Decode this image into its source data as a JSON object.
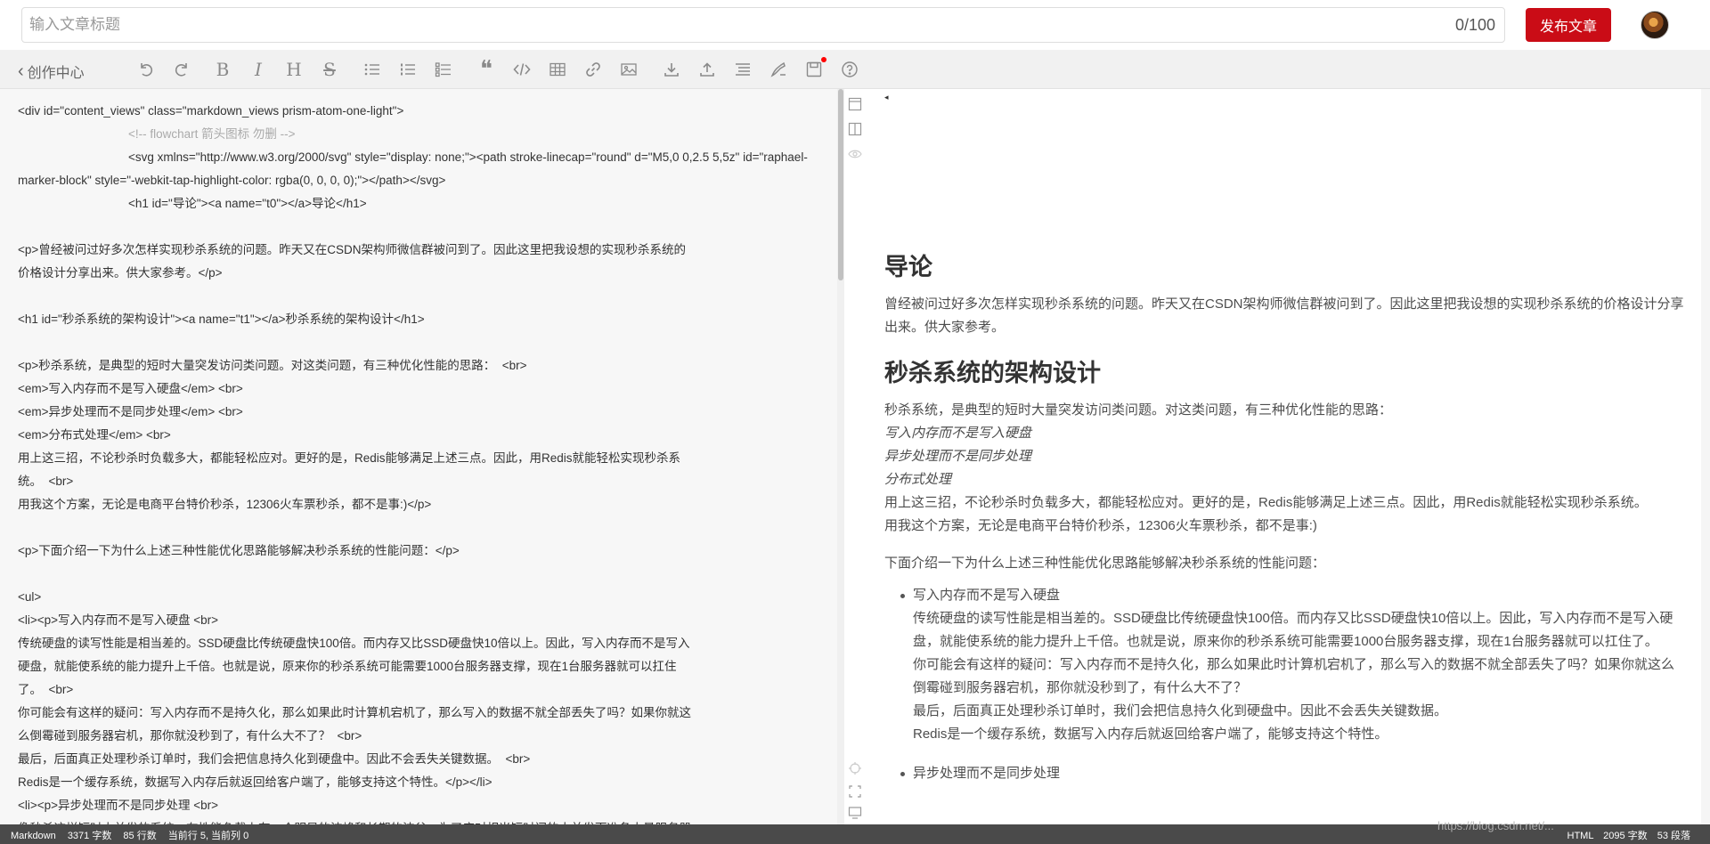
{
  "title": {
    "placeholder": "输入文章标题",
    "count": "0/100"
  },
  "publish_label": "发布文章",
  "toolbar": {
    "back_label": "创作中心"
  },
  "editor_lines": [
    {
      "t": "<div id=\"content_views\" class=\"markdown_views prism-atom-one-light\">",
      "k": "n"
    },
    {
      "t": "<!-- flowchart 箭头图标 勿删 -->",
      "k": "c"
    },
    {
      "t": "<svg xmlns=\"http://www.w3.org/2000/svg\" style=\"display: none;\"><path stroke-linecap=\"round\" d=\"M5,0 0,2.5 5,5z\" id=\"raphael-",
      "k": "i"
    },
    {
      "t": "marker-block\" style=\"-webkit-tap-highlight-color: rgba(0, 0, 0, 0);\"></path></svg>",
      "k": "n"
    },
    {
      "t": "<h1 id=\"导论\"><a name=\"t0\"></a>导论</h1>",
      "k": "i"
    },
    {
      "t": "",
      "k": "b"
    },
    {
      "t": "<p>曾经被问过好多次怎样实现秒杀系统的问题。昨天又在CSDN架构师微信群被问到了。因此这里把我设想的实现秒杀系统的",
      "k": "n"
    },
    {
      "t": "价格设计分享出来。供大家参考。</p>",
      "k": "n"
    },
    {
      "t": "",
      "k": "b"
    },
    {
      "t": "<h1 id=\"秒杀系统的架构设计\"><a name=\"t1\"></a>秒杀系统的架构设计</h1>",
      "k": "n"
    },
    {
      "t": "",
      "k": "b"
    },
    {
      "t": "<p>秒杀系统，是典型的短时大量突发访问类问题。对这类问题，有三种优化性能的思路：  <br>",
      "k": "n"
    },
    {
      "t": "<em>写入内存而不是写入硬盘</em> <br>",
      "k": "n"
    },
    {
      "t": "<em>异步处理而不是同步处理</em> <br>",
      "k": "n"
    },
    {
      "t": "<em>分布式处理</em> <br>",
      "k": "n"
    },
    {
      "t": "用上这三招，不论秒杀时负载多大，都能轻松应对。更好的是，Redis能够满足上述三点。因此，用Redis就能轻松实现秒杀系",
      "k": "n"
    },
    {
      "t": "统。  <br>",
      "k": "n"
    },
    {
      "t": "用我这个方案，无论是电商平台特价秒杀，12306火车票秒杀，都不是事:)</p>",
      "k": "n"
    },
    {
      "t": "",
      "k": "b"
    },
    {
      "t": "<p>下面介绍一下为什么上述三种性能优化思路能够解决秒杀系统的性能问题：</p>",
      "k": "n"
    },
    {
      "t": "",
      "k": "b"
    },
    {
      "t": "<ul>",
      "k": "n"
    },
    {
      "t": "<li><p>写入内存而不是写入硬盘 <br>",
      "k": "n"
    },
    {
      "t": "传统硬盘的读写性能是相当差的。SSD硬盘比传统硬盘快100倍。而内存又比SSD硬盘快10倍以上。因此，写入内存而不是写入",
      "k": "n"
    },
    {
      "t": "硬盘，就能使系统的能力提升上千倍。也就是说，原来你的秒杀系统可能需要1000台服务器支撑，现在1台服务器就可以扛住",
      "k": "n"
    },
    {
      "t": "了。  <br>",
      "k": "n"
    },
    {
      "t": "你可能会有这样的疑问：写入内存而不是持久化，那么如果此时计算机宕机了，那么写入的数据不就全部丢失了吗？如果你就这",
      "k": "n"
    },
    {
      "t": "么倒霉碰到服务器宕机，那你就没秒到了，有什么大不了？  <br>",
      "k": "n"
    },
    {
      "t": "最后，后面真正处理秒杀订单时，我们会把信息持久化到硬盘中。因此不会丢失关键数据。  <br>",
      "k": "n"
    },
    {
      "t": "Redis是一个缓存系统，数据写入内存后就返回给客户端了，能够支持这个特性。</p></li>",
      "k": "n"
    },
    {
      "t": "<li><p>异步处理而不是同步处理 <br>",
      "k": "n"
    },
    {
      "t": "像秒杀这样短时大并发的系统，在性能负载上有一个明显的波峰和长期的波谷。为了应对相当短时间的大并发而准备大量服务器",
      "k": "n"
    }
  ],
  "preview": {
    "arrow_glyph": "◂",
    "h1_intro": "导论",
    "p_intro": "曾经被问过好多次怎样实现秒杀系统的问题。昨天又在CSDN架构师微信群被问到了。因此这里把我设想的实现秒杀系统的价格设计分享出来。供大家参考。",
    "h1_arch": "秒杀系统的架构设计",
    "p1_l1": "秒杀系统，是典型的短时大量突发访问类问题。对这类问题，有三种优化性能的思路：",
    "em1": "写入内存而不是写入硬盘",
    "em2": "异步处理而不是同步处理",
    "em3": "分布式处理",
    "p1_l2": "用上这三招，不论秒杀时负载多大，都能轻松应对。更好的是，Redis能够满足上述三点。因此，用Redis就能轻松实现秒杀系统。",
    "p1_l3": "用我这个方案，无论是电商平台特价秒杀，12306火车票秒杀，都不是事:)",
    "p2": "下面介绍一下为什么上述三种性能优化思路能够解决秒杀系统的性能问题：",
    "li1_title": "写入内存而不是写入硬盘",
    "li1_a": "传统硬盘的读写性能是相当差的。SSD硬盘比传统硬盘快100倍。而内存又比SSD硬盘快10倍以上。因此，写入内存而不是写入硬盘，就能使系统的能力提升上千倍。也就是说，原来你的秒杀系统可能需要1000台服务器支撑，现在1台服务器就可以扛住了。",
    "li1_b": "你可能会有这样的疑问：写入内存而不是持久化，那么如果此时计算机宕机了，那么写入的数据不就全部丢失了吗？如果你就这么倒霉碰到服务器宕机，那你就没秒到了，有什么大不了？",
    "li1_c": "最后，后面真正处理秒杀订单时，我们会把信息持久化到硬盘中。因此不会丢失关键数据。",
    "li1_d": "Redis是一个缓存系统，数据写入内存后就返回给客户端了，能够支持这个特性。",
    "li2_title": "异步处理而不是同步处理"
  },
  "status": {
    "mode": "Markdown",
    "chars": "3371 字数",
    "lines": "85 行数",
    "cur_line": "当前行 5, 当前列 0",
    "right_mode": "HTML",
    "right_chars": "2095 字数",
    "right_paras": "53 段落"
  },
  "watermark": "https://blog.csdn.net/..."
}
